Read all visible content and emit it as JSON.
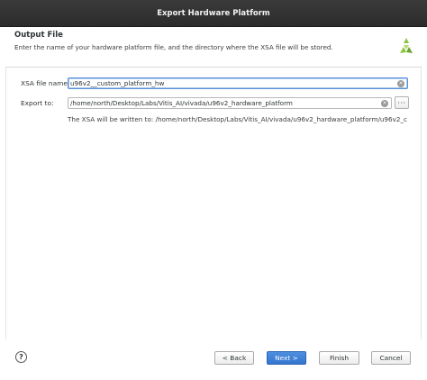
{
  "window": {
    "title": "Export Hardware Platform"
  },
  "header": {
    "title": "Output File",
    "description": "Enter the name of your hardware platform file, and the directory where the XSA file will be stored."
  },
  "form": {
    "xsa_label": "XSA file name:",
    "xsa_value": "u96v2__custom_platform_hw",
    "export_label": "Export to:",
    "export_value": "/home/north/Desktop/Labs/Vitis_AI/vivada/u96v2_hardware_platform",
    "browse_label": "···",
    "info_text": "The XSA will be written to: /home/north/Desktop/Labs/Vitis_AI/vivada/u96v2_hardware_platform/u96v2_c"
  },
  "footer": {
    "help_label": "?",
    "back_label": "< Back",
    "next_label": "Next >",
    "finish_label": "Finish",
    "cancel_label": "Cancel"
  },
  "colors": {
    "accent": "#3a7bd5",
    "titlebar": "#2f2f2f",
    "logo_green": "#8cc63f"
  }
}
